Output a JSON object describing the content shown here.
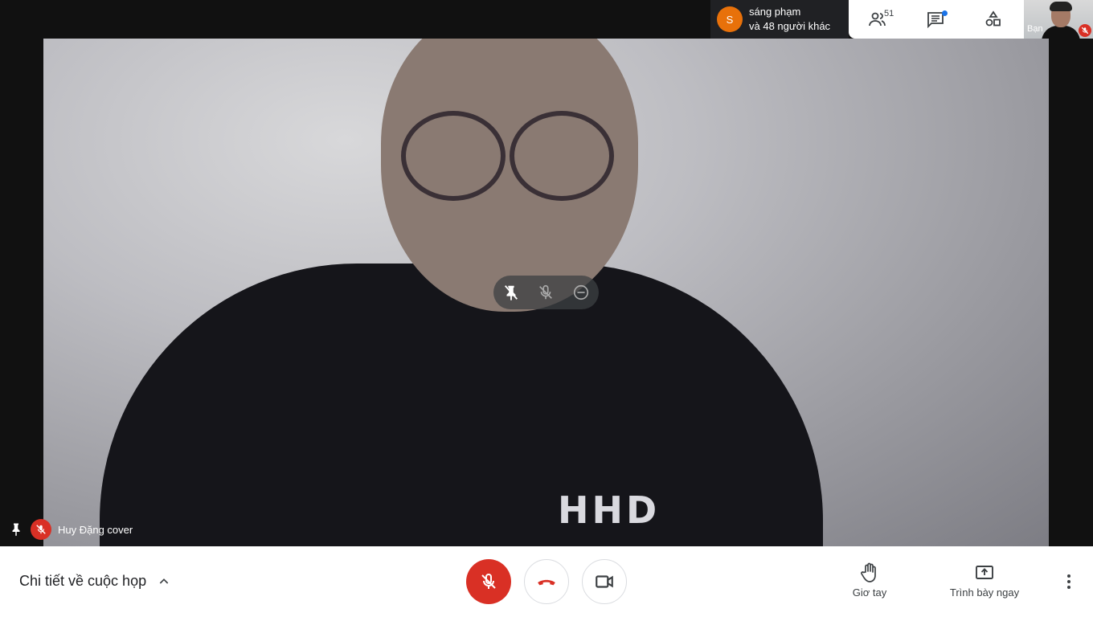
{
  "topbar": {
    "presenter_avatar_letter": "S",
    "presenter_line1": "sáng phạm",
    "presenter_line2": "và 48 người khác",
    "participants_count": "51",
    "self_label": "Bạn"
  },
  "main_tile": {
    "participant_name": "Huy Đặng cover",
    "shirt_text": "HHD"
  },
  "bottombar": {
    "details_label": "Chi tiết về cuộc họp",
    "raise_hand_label": "Giơ tay",
    "present_label": "Trình bày ngay"
  },
  "colors": {
    "accent_red": "#d93025",
    "avatar_orange": "#e8710a",
    "chat_dot": "#1a73e8"
  }
}
